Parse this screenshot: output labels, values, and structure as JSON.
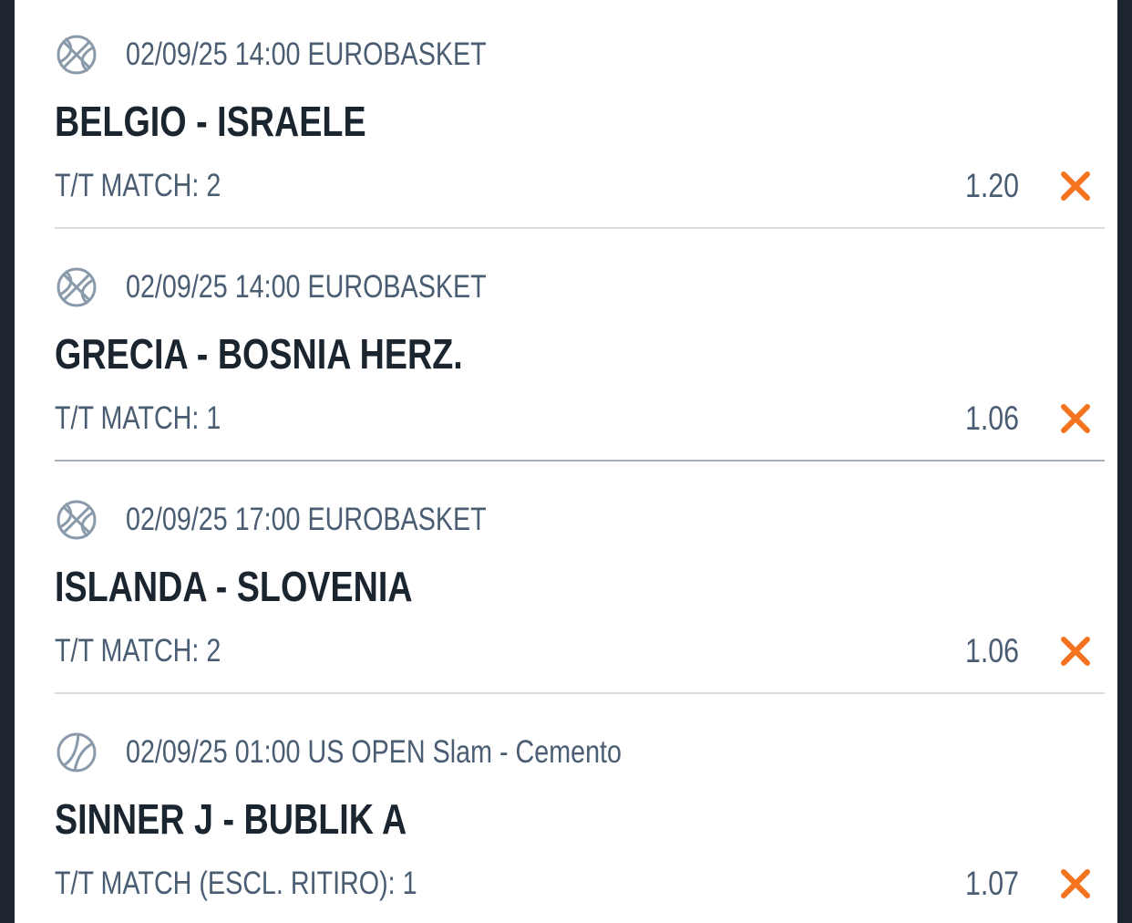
{
  "colors": {
    "accent_remove": "#f4731f",
    "text_primary": "#1b2530",
    "text_secondary": "#4a5d72",
    "frame": "#1c2530"
  },
  "bets": [
    {
      "sport_icon": "basketball-icon",
      "meta": "02/09/25 14:00 EUROBASKET",
      "match": "BELGIO - ISRAELE",
      "market": "T/T MATCH: 2",
      "odds": "1.20",
      "remove_icon": "close-icon"
    },
    {
      "sport_icon": "basketball-icon",
      "meta": "02/09/25 14:00 EUROBASKET",
      "match": "GRECIA - BOSNIA HERZ.",
      "market": "T/T MATCH: 1",
      "odds": "1.06",
      "remove_icon": "close-icon"
    },
    {
      "sport_icon": "basketball-icon",
      "meta": "02/09/25 17:00 EUROBASKET",
      "match": "ISLANDA - SLOVENIA",
      "market": "T/T MATCH: 2",
      "odds": "1.06",
      "remove_icon": "close-icon"
    },
    {
      "sport_icon": "tennis-ball-icon",
      "meta": "02/09/25 01:00 US OPEN Slam - Cemento",
      "match": "SINNER J - BUBLIK A",
      "market": "T/T MATCH (ESCL. RITIRO): 1",
      "odds": "1.07",
      "remove_icon": "close-icon"
    }
  ]
}
